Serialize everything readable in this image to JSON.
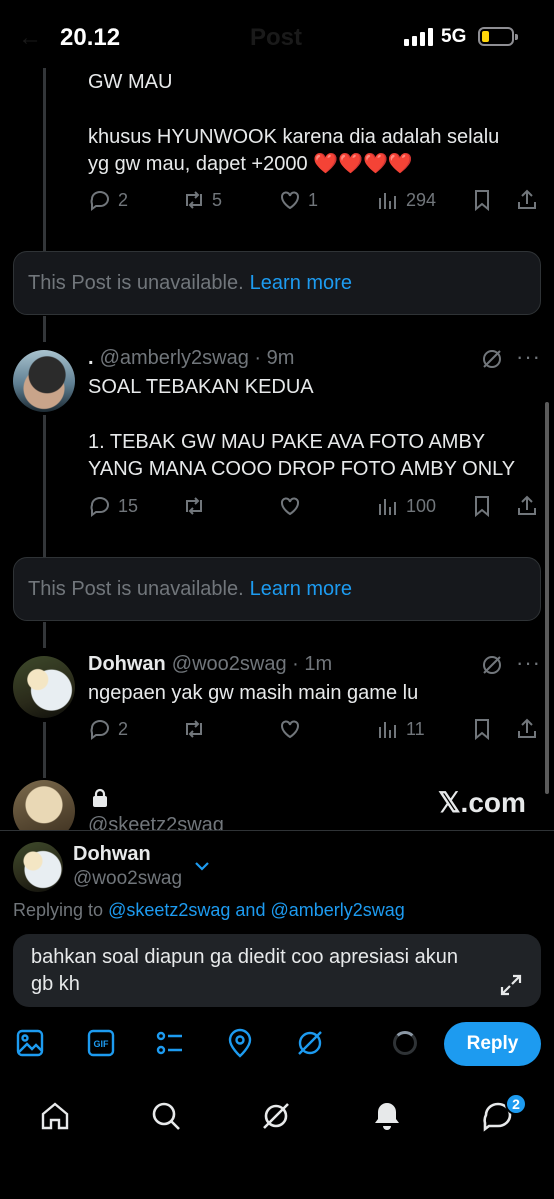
{
  "status_bar": {
    "time": "20.12",
    "network": "5G",
    "header_title": "Post"
  },
  "tweet_top": {
    "text_line1": "GW MAU",
    "text_line2": "khusus HYUNWOOK karena dia adalah selalu",
    "text_line3": "yg gw mau, dapet +2000 ❤️❤️❤️❤️",
    "replies": "2",
    "reposts": "5",
    "likes": "1",
    "views": "294"
  },
  "unavailable_1": {
    "text": "This Post is unavailable.",
    "link": "Learn more"
  },
  "tweet_amberly": {
    "name": ".",
    "handle": "@amberly2swag",
    "time": "9m",
    "line1": "SOAL TEBAKAN KEDUA",
    "line2": "1. TEBAK GW MAU PAKE AVA FOTO AMBY",
    "line3": "YANG MANA COOO DROP FOTO AMBY ONLY",
    "replies": "15",
    "views": "100"
  },
  "unavailable_2": {
    "text": "This Post is unavailable.",
    "link": "Learn more"
  },
  "tweet_dohwan": {
    "name": "Dohwan",
    "handle": "@woo2swag",
    "time": "1m",
    "text": "ngepaen yak gw masih main game lu",
    "replies": "2",
    "views": "11"
  },
  "tweet_skeetz": {
    "handle": "@skeetz2swag"
  },
  "watermark": "𝕏.com",
  "compose": {
    "account_name": "Dohwan",
    "account_handle": "@woo2swag",
    "replying_prefix": "Replying to",
    "reply_to_1": "@skeetz2swag",
    "reply_and": "and",
    "reply_to_2": "@amberly2swag",
    "draft_line1": "bahkan soal diapun ga diedit coo apresiasi akun",
    "draft_line2": "gb kh",
    "reply_button": "Reply"
  },
  "tabbar": {
    "messages_badge": "2"
  },
  "colors": {
    "accent": "#1d9bf0",
    "muted": "#71767b",
    "background": "#000000"
  }
}
